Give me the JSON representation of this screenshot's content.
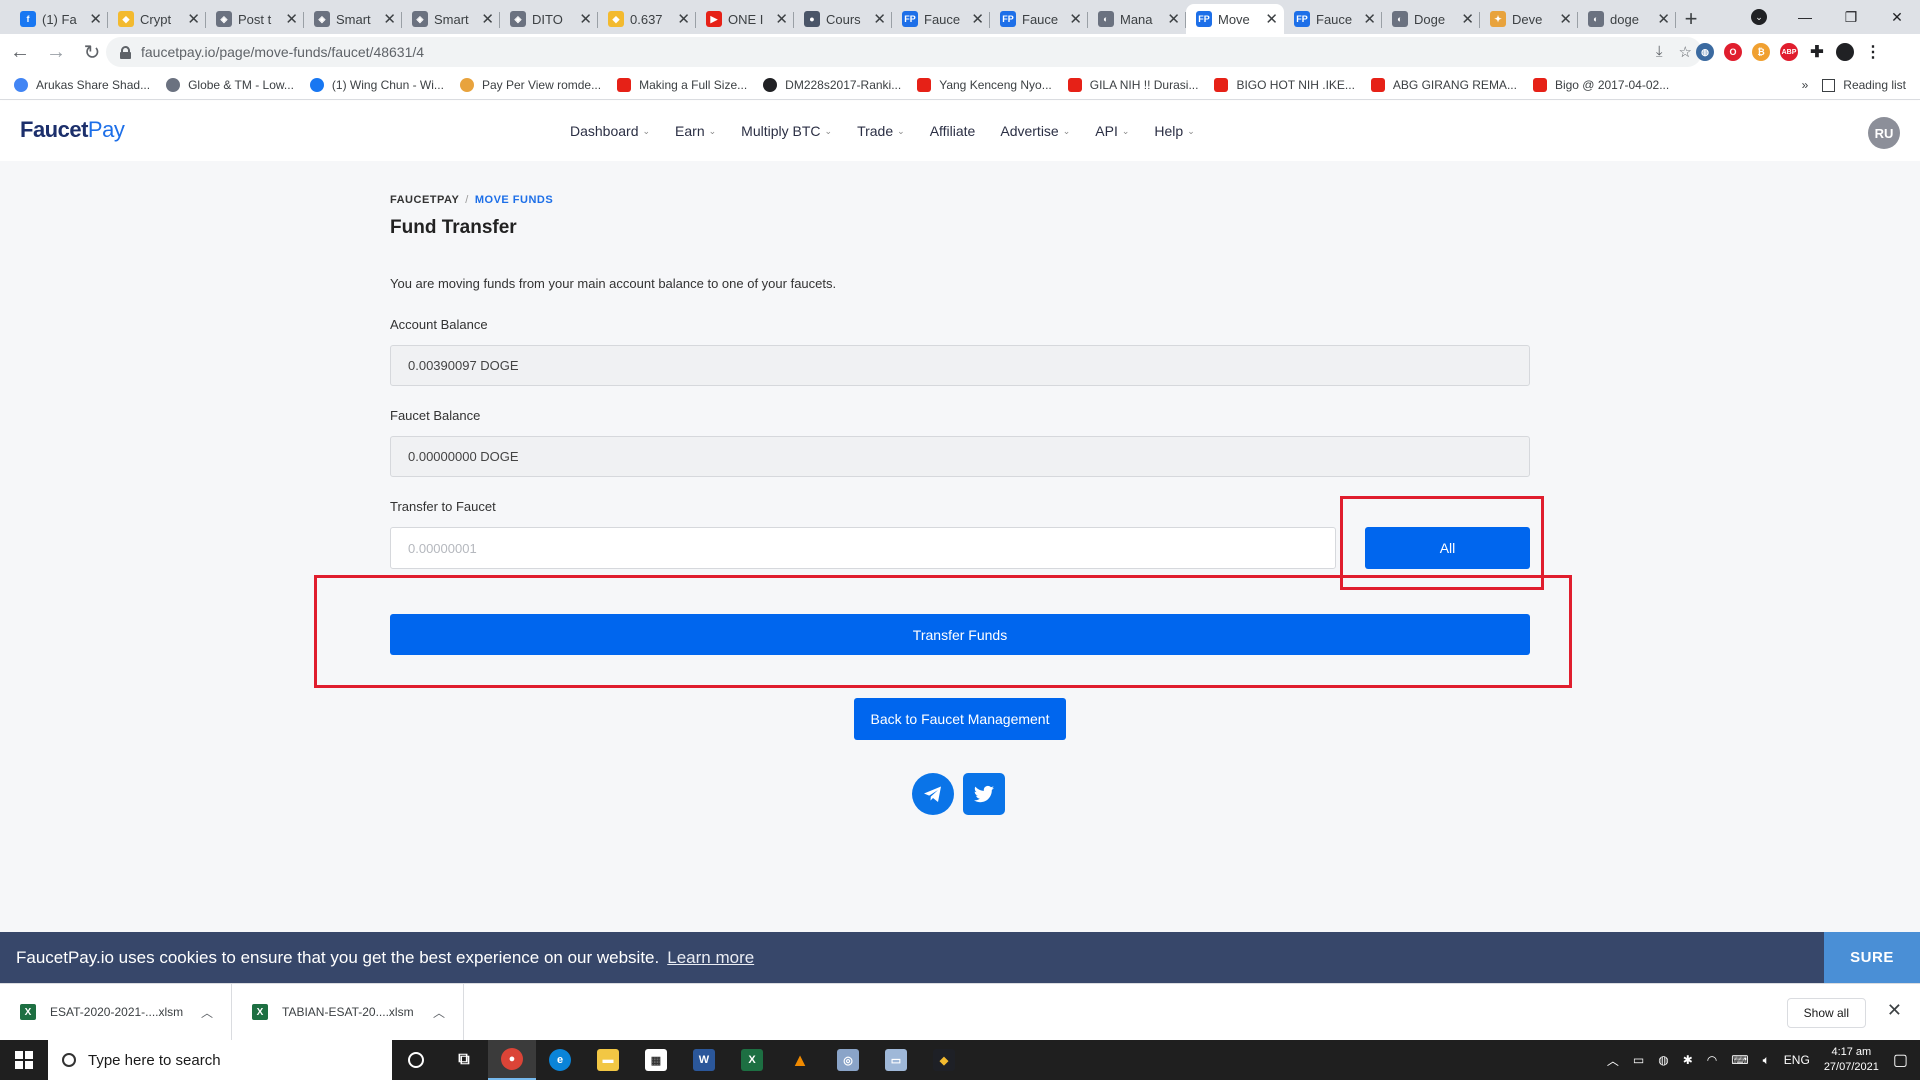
{
  "browser": {
    "tabs": [
      {
        "title": "(1) Fa",
        "color": "#1877f2",
        "glyph": "f"
      },
      {
        "title": "Crypt",
        "color": "#f3ba2f",
        "glyph": "◆"
      },
      {
        "title": "Post t",
        "color": "#6b7280",
        "glyph": "◈"
      },
      {
        "title": "Smart",
        "color": "#6b7280",
        "glyph": "◈"
      },
      {
        "title": "Smart",
        "color": "#6b7280",
        "glyph": "◈"
      },
      {
        "title": "DITO",
        "color": "#6b7280",
        "glyph": "◈"
      },
      {
        "title": "0.637",
        "color": "#f3ba2f",
        "glyph": "◆"
      },
      {
        "title": "ONE I",
        "color": "#e62117",
        "glyph": "▶"
      },
      {
        "title": "Cours",
        "color": "#4a5568",
        "glyph": "●"
      },
      {
        "title": "Fauce",
        "color": "#1d6fe8",
        "glyph": "FP"
      },
      {
        "title": "Fauce",
        "color": "#1d6fe8",
        "glyph": "FP"
      },
      {
        "title": "Mana",
        "color": "#6b7280",
        "glyph": "◐"
      },
      {
        "title": "Move",
        "color": "#1d6fe8",
        "glyph": "FP",
        "active": true
      },
      {
        "title": "Fauce",
        "color": "#1d6fe8",
        "glyph": "FP"
      },
      {
        "title": "Doge",
        "color": "#6b7280",
        "glyph": "◐"
      },
      {
        "title": "Deve",
        "color": "#e8a33d",
        "glyph": "✦"
      },
      {
        "title": "doge",
        "color": "#6b7280",
        "glyph": "◐"
      }
    ],
    "url": "faucetpay.io/page/move-funds/faucet/48631/4",
    "bookmarks": [
      {
        "label": "Arukas Share Shad...",
        "color": "#4285f4",
        "type": "g"
      },
      {
        "label": "Globe & TM - Low...",
        "color": "#6b7280",
        "type": "icon"
      },
      {
        "label": "(1) Wing Chun - Wi...",
        "color": "#1877f2",
        "type": "icon"
      },
      {
        "label": "Pay Per View romde...",
        "color": "#e8a33d",
        "type": "icon"
      },
      {
        "label": "Making a Full Size...",
        "color": "#e62117",
        "type": "yt"
      },
      {
        "label": "DM228s2017-Ranki...",
        "color": "#202124",
        "type": "icon"
      },
      {
        "label": "Yang Kenceng Nyo...",
        "color": "#e62117",
        "type": "yt"
      },
      {
        "label": "GILA NIH !! Durasi...",
        "color": "#e62117",
        "type": "yt"
      },
      {
        "label": "BIGO HOT NIH .IKE...",
        "color": "#e62117",
        "type": "yt"
      },
      {
        "label": "ABG GIRANG REMA...",
        "color": "#e62117",
        "type": "yt"
      },
      {
        "label": "Bigo @ 2017-04-02...",
        "color": "#e62117",
        "type": "yt"
      }
    ],
    "bookmarks_more": "»",
    "reading_list": "Reading list"
  },
  "site": {
    "logo_part1": "Faucet",
    "logo_part2": "Pay",
    "nav": [
      {
        "label": "Dashboard",
        "dropdown": true
      },
      {
        "label": "Earn",
        "dropdown": true
      },
      {
        "label": "Multiply BTC",
        "dropdown": true
      },
      {
        "label": "Trade",
        "dropdown": true
      },
      {
        "label": "Affiliate",
        "dropdown": false
      },
      {
        "label": "Advertise",
        "dropdown": true
      },
      {
        "label": "API",
        "dropdown": true
      },
      {
        "label": "Help",
        "dropdown": true
      }
    ],
    "avatar_initials": "RU"
  },
  "page": {
    "breadcrumb_root": "FAUCETPAY",
    "breadcrumb_sep": "/",
    "breadcrumb_current": "MOVE FUNDS",
    "title": "Fund Transfer",
    "description": "You are moving funds from your main account balance to one of your faucets.",
    "account_balance_label": "Account Balance",
    "account_balance_value": "0.00390097 DOGE",
    "faucet_balance_label": "Faucet Balance",
    "faucet_balance_value": "0.00000000 DOGE",
    "transfer_label": "Transfer to Faucet",
    "transfer_placeholder": "0.00000001",
    "all_button": "All",
    "transfer_button": "Transfer Funds",
    "back_button": "Back to Faucet Management"
  },
  "cookie": {
    "message": "FaucetPay.io uses cookies to ensure that you get the best experience on our website.",
    "learn_more": "Learn more",
    "accept": "SURE"
  },
  "downloads": {
    "items": [
      {
        "name": "ESAT-2020-2021-....xlsm"
      },
      {
        "name": "TABIAN-ESAT-20....xlsm"
      }
    ],
    "show_all": "Show all"
  },
  "taskbar": {
    "search_placeholder": "Type here to search",
    "language": "ENG",
    "time": "4:17 am",
    "date": "27/07/2021"
  },
  "colors": {
    "primary": "#0066ee",
    "highlight": "#e01e2e",
    "cookie_bg": "#37476a"
  }
}
